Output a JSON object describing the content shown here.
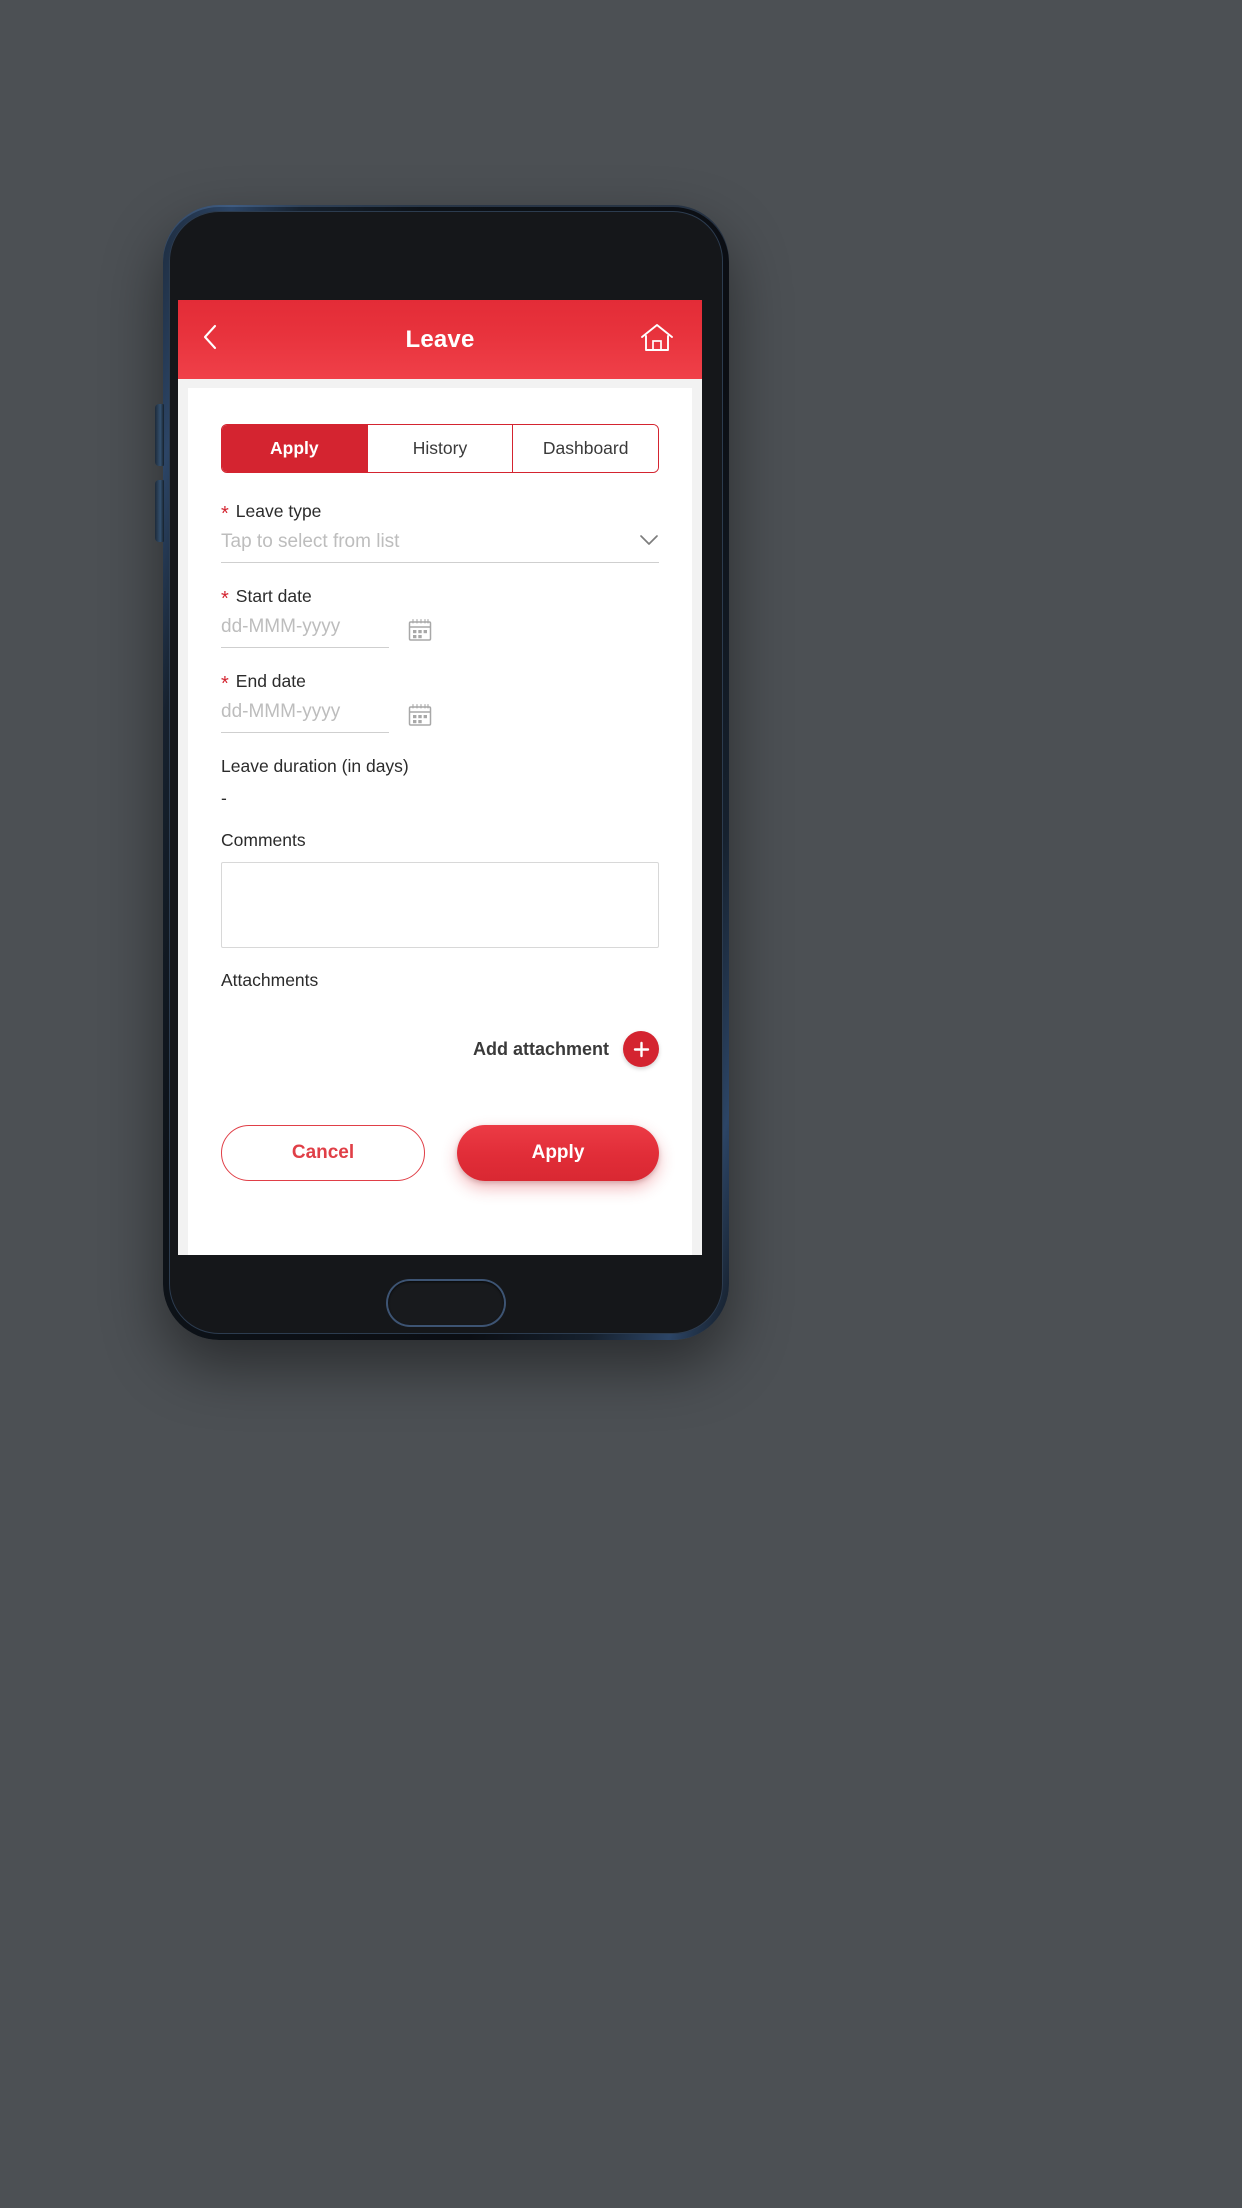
{
  "app_bar": {
    "title": "Leave",
    "back_icon": "chevron-left-icon",
    "home_icon": "home-icon"
  },
  "tabs": [
    {
      "label": "Apply",
      "active": true
    },
    {
      "label": "History",
      "active": false
    },
    {
      "label": "Dashboard",
      "active": false
    }
  ],
  "form": {
    "leave_type": {
      "label": "Leave type",
      "required_marker": "*",
      "placeholder": "Tap to select from list",
      "value": "",
      "chevron_icon": "chevron-down-icon"
    },
    "start_date": {
      "label": "Start date",
      "required_marker": "*",
      "placeholder": "dd-MMM-yyyy",
      "value": "",
      "calendar_icon": "calendar-icon"
    },
    "end_date": {
      "label": "End date",
      "required_marker": "*",
      "placeholder": "dd-MMM-yyyy",
      "value": "",
      "calendar_icon": "calendar-icon"
    },
    "leave_duration": {
      "label": "Leave duration (in days)",
      "value": "-"
    },
    "comments": {
      "label": "Comments",
      "placeholder": "",
      "value": ""
    },
    "attachments": {
      "label": "Attachments",
      "add_label": "Add attachment",
      "add_icon": "plus-icon"
    }
  },
  "actions": {
    "cancel_label": "Cancel",
    "apply_label": "Apply"
  },
  "colors": {
    "brand_red": "#d42430",
    "app_bar_red": "#e8333d",
    "apply_red": "#e12d38",
    "placeholder_grey": "#bdbdbd",
    "page_background": "#4c5054"
  }
}
